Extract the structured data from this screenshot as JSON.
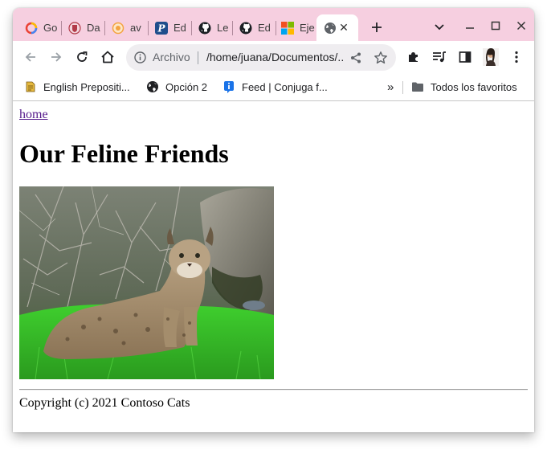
{
  "browser": {
    "tabs": [
      {
        "label": "Go",
        "icon": "google-icon"
      },
      {
        "label": "Da",
        "icon": "shield-crest-icon"
      },
      {
        "label": "av",
        "icon": "orange-circle-icon"
      },
      {
        "label": "Ed",
        "icon": "p-letter-icon"
      },
      {
        "label": "Le",
        "icon": "github-icon"
      },
      {
        "label": "Ed",
        "icon": "github-icon"
      },
      {
        "label": "Eje",
        "icon": "microsoft-icon"
      },
      {
        "label": "",
        "icon": "globe-icon",
        "active": true
      }
    ],
    "new_tab_label": "+",
    "omnibox": {
      "chip": "Archivo",
      "url": "/home/juana/Documentos/..."
    },
    "bookmarks": [
      {
        "label": "English Prepositi...",
        "icon": "document-icon"
      },
      {
        "label": "Opción 2",
        "icon": "globe-icon"
      },
      {
        "label": "Feed | Conjuga f...",
        "icon": "info-icon"
      }
    ],
    "bookmarks_overflow": "»",
    "all_bookmarks": "Todos los favoritos",
    "colors": {
      "tabstrip": "#f6cfe0",
      "omnibox": "#efedf0",
      "link": "#551a8b"
    }
  },
  "page": {
    "home_link": "home",
    "title": "Our Feline Friends",
    "image_subject": "bobcat sitting in grass",
    "copyright": "Copyright (c) 2021 Contoso Cats"
  }
}
